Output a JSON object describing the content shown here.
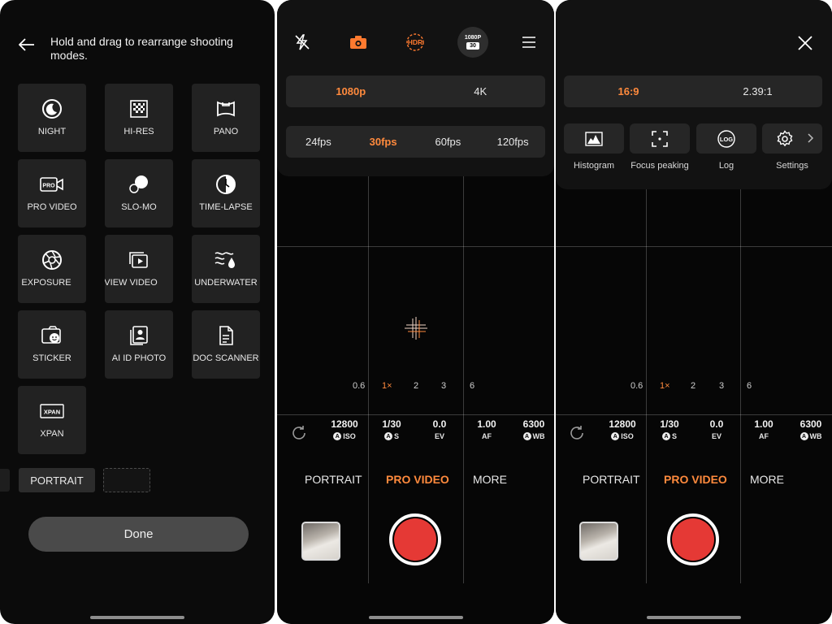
{
  "edit_modes": {
    "title": "Hold and drag to rearrange shooting modes.",
    "tiles": [
      {
        "label": "NIGHT",
        "icon": "moon-icon"
      },
      {
        "label": "HI-RES",
        "icon": "hi-res-grid-icon"
      },
      {
        "label": "PANO",
        "icon": "pano-icon"
      },
      {
        "label": "PRO VIDEO",
        "icon": "pro-video-icon"
      },
      {
        "label": "SLO-MO",
        "icon": "slo-mo-icon"
      },
      {
        "label": "TIME-LAPSE",
        "icon": "time-lapse-icon"
      },
      {
        "label": "EXPOSURE",
        "icon": "aperture-icon"
      },
      {
        "label": "VIEW VIDEO",
        "icon": "view-video-icon"
      },
      {
        "label": "UNDERWATER",
        "icon": "underwater-icon"
      },
      {
        "label": "STICKER",
        "icon": "sticker-icon"
      },
      {
        "label": "AI ID PHOTO",
        "icon": "id-photo-icon"
      },
      {
        "label": "DOC SCANNER",
        "icon": "doc-scanner-icon"
      },
      {
        "label": "XPAN",
        "icon": "xpan-icon"
      }
    ],
    "xpan_badge": "XPAN",
    "pro_badge": "PRO",
    "tray_item": "PORTRAIT",
    "done_label": "Done"
  },
  "camera": {
    "topbar": {
      "hdr_label": "HDR",
      "res_badge_top": "1080P",
      "res_badge_bottom": "30"
    },
    "resolution": {
      "options": [
        "1080p",
        "4K"
      ],
      "selected": "1080p"
    },
    "framerate": {
      "options": [
        "24fps",
        "30fps",
        "60fps",
        "120fps"
      ],
      "selected": "30fps"
    },
    "zoom": [
      "0.6",
      "1×",
      "2",
      "3",
      "6"
    ],
    "params": [
      {
        "value": "12800",
        "label": "ISO",
        "auto": true
      },
      {
        "value": "1/30",
        "label": "S",
        "auto": true
      },
      {
        "value": "0.0",
        "label": "EV",
        "auto": false
      },
      {
        "value": "1.00",
        "label": "AF",
        "auto": false
      },
      {
        "value": "6300",
        "label": "WB",
        "auto": true
      }
    ],
    "modes": [
      "PORTRAIT",
      "PRO VIDEO",
      "MORE"
    ],
    "active_mode": "PRO VIDEO",
    "auto_badge": "A"
  },
  "settings_panel": {
    "aspect": {
      "options": [
        "16:9",
        "2.39:1"
      ],
      "selected": "16:9"
    },
    "tools": [
      {
        "label": "Histogram",
        "icon": "histogram-icon"
      },
      {
        "label": "Focus peaking",
        "icon": "focus-peaking-icon"
      },
      {
        "label": "Log",
        "icon": "log-icon"
      },
      {
        "label": "Settings",
        "icon": "gear-icon"
      }
    ],
    "log_badge": "LOG"
  },
  "colors": {
    "accent": "#ff8a3d",
    "record": "#e53935"
  }
}
